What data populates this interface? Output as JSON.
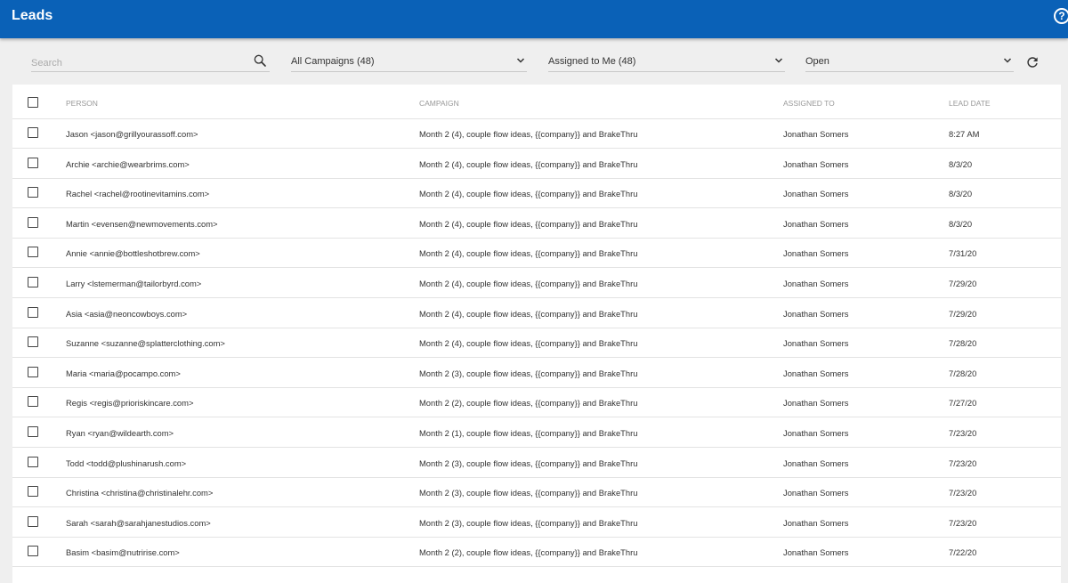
{
  "header": {
    "title": "Leads",
    "help_icon": "help-circle-icon"
  },
  "filters": {
    "search_placeholder": "Search",
    "search_value": "",
    "campaign": "All Campaigns (48)",
    "assignee": "Assigned to Me (48)",
    "status": "Open"
  },
  "table": {
    "columns": [
      "PERSON",
      "CAMPAIGN",
      "ASSIGNED TO",
      "LEAD DATE"
    ],
    "rows": [
      {
        "person": "Jason <jason@grillyourassoff.com>",
        "campaign": "Month 2 (4), couple flow ideas, {{company}} and BrakeThru",
        "assigned": "Jonathan Somers",
        "date": "8:27 AM"
      },
      {
        "person": "Archie <archie@wearbrims.com>",
        "campaign": "Month 2 (4), couple flow ideas, {{company}} and BrakeThru",
        "assigned": "Jonathan Somers",
        "date": "8/3/20"
      },
      {
        "person": "Rachel <rachel@rootinevitamins.com>",
        "campaign": "Month 2 (4), couple flow ideas, {{company}} and BrakeThru",
        "assigned": "Jonathan Somers",
        "date": "8/3/20"
      },
      {
        "person": "Martin <evensen@newmovements.com>",
        "campaign": "Month 2 (4), couple flow ideas, {{company}} and BrakeThru",
        "assigned": "Jonathan Somers",
        "date": "8/3/20"
      },
      {
        "person": "Annie <annie@bottleshotbrew.com>",
        "campaign": "Month 2 (4), couple flow ideas, {{company}} and BrakeThru",
        "assigned": "Jonathan Somers",
        "date": "7/31/20"
      },
      {
        "person": "Larry <lstemerman@tailorbyrd.com>",
        "campaign": "Month 2 (4), couple flow ideas, {{company}} and BrakeThru",
        "assigned": "Jonathan Somers",
        "date": "7/29/20"
      },
      {
        "person": "Asia <asia@neoncowboys.com>",
        "campaign": "Month 2 (4), couple flow ideas, {{company}} and BrakeThru",
        "assigned": "Jonathan Somers",
        "date": "7/29/20"
      },
      {
        "person": "Suzanne <suzanne@splatterclothing.com>",
        "campaign": "Month 2 (4), couple flow ideas, {{company}} and BrakeThru",
        "assigned": "Jonathan Somers",
        "date": "7/28/20"
      },
      {
        "person": "Maria <maria@pocampo.com>",
        "campaign": "Month 2 (3), couple flow ideas, {{company}} and BrakeThru",
        "assigned": "Jonathan Somers",
        "date": "7/28/20"
      },
      {
        "person": "Regis <regis@prioriskincare.com>",
        "campaign": "Month 2 (2), couple flow ideas, {{company}} and BrakeThru",
        "assigned": "Jonathan Somers",
        "date": "7/27/20"
      },
      {
        "person": "Ryan <ryan@wildearth.com>",
        "campaign": "Month 2 (1), couple flow ideas, {{company}} and BrakeThru",
        "assigned": "Jonathan Somers",
        "date": "7/23/20"
      },
      {
        "person": "Todd <todd@plushinarush.com>",
        "campaign": "Month 2 (3), couple flow ideas, {{company}} and BrakeThru",
        "assigned": "Jonathan Somers",
        "date": "7/23/20"
      },
      {
        "person": "Christina <christina@christinalehr.com>",
        "campaign": "Month 2 (3), couple flow ideas, {{company}} and BrakeThru",
        "assigned": "Jonathan Somers",
        "date": "7/23/20"
      },
      {
        "person": "Sarah <sarah@sarahjanestudios.com>",
        "campaign": "Month 2 (3), couple flow ideas, {{company}} and BrakeThru",
        "assigned": "Jonathan Somers",
        "date": "7/23/20"
      },
      {
        "person": "Basim <basim@nutririse.com>",
        "campaign": "Month 2 (2), couple flow ideas, {{company}} and BrakeThru",
        "assigned": "Jonathan Somers",
        "date": "7/22/20"
      }
    ]
  },
  "colors": {
    "header_bg": "#0a61b7",
    "page_bg": "#efefef"
  }
}
